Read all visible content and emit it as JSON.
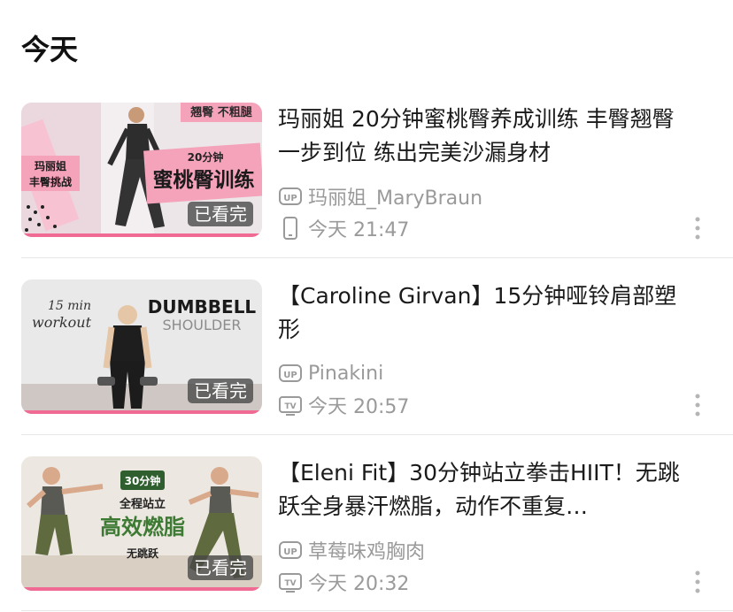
{
  "section": {
    "title": "今天"
  },
  "items": [
    {
      "title": "玛丽姐 20分钟蜜桃臀养成训练 丰臀翘臀一步到位 练出完美沙漏身材",
      "author": "玛丽姐_MaryBraun",
      "time": "今天 21:47",
      "watched_label": "已看完",
      "progress": 1.0,
      "device": "phone-icon",
      "thumb_text": {
        "tag": "翘臀 不粗腿",
        "tag2": "玛丽姐\n丰臀挑战",
        "minutes": "20分钟",
        "headline": "蜜桃臀训练"
      }
    },
    {
      "title": "【Caroline Girvan】15分钟哑铃肩部塑形",
      "author": "Pinakini",
      "time": "今天 20:57",
      "watched_label": "已看完",
      "progress": 1.0,
      "device": "tv-icon",
      "thumb_text": {
        "script1": "15 min",
        "script2": "workout",
        "headline": "DUMBBELL",
        "sub": "SHOULDER"
      }
    },
    {
      "title": "【Eleni Fit】30分钟站立拳击HIIT！无跳跃全身暴汗燃脂，动作不重复…",
      "author": "草莓味鸡胸肉",
      "time": "今天 20:32",
      "watched_label": "已看完",
      "progress": 1.0,
      "device": "tv-icon",
      "thumb_text": {
        "minutes": "30分钟",
        "line1": "全程站立",
        "headline": "高效燃脂",
        "line3": "无跳跃"
      }
    }
  ],
  "colors": {
    "accent": "#f06a93",
    "meta": "#9a9a9a"
  }
}
